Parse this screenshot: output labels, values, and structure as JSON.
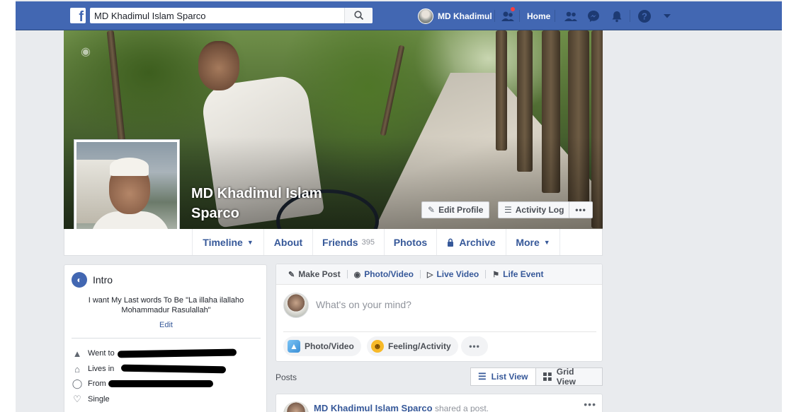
{
  "topbar": {
    "search_value": "MD Khadimul Islam Sparco",
    "user_label": "MD Khadimul",
    "home_label": "Home"
  },
  "profile": {
    "name": "MD Khadimul Islam Sparco",
    "edit_profile_label": "Edit Profile",
    "activity_log_label": "Activity Log"
  },
  "profile_nav": {
    "timeline": "Timeline",
    "about": "About",
    "friends": "Friends",
    "friends_count": "395",
    "photos": "Photos",
    "archive": "Archive",
    "more": "More"
  },
  "intro": {
    "title": "Intro",
    "bio": "I want My Last words To Be \"La illaha ilallaho Mohammadur Rasulallah\"",
    "edit_label": "Edit",
    "went_to_prefix": "Went to",
    "lives_in_prefix": "Lives in",
    "from_prefix": "From",
    "relationship": "Single"
  },
  "composer": {
    "tabs": [
      "Make Post",
      "Photo/Video",
      "Live Video",
      "Life Event"
    ],
    "placeholder": "What's on your mind?",
    "photo_video_pill": "Photo/Video",
    "feeling_pill": "Feeling/Activity"
  },
  "posts": {
    "label": "Posts",
    "list_view": "List View",
    "grid_view": "Grid View",
    "first_post_author": "MD Khadimul Islam Sparco",
    "first_post_action": "shared a post."
  },
  "colors": {
    "brand": "#4267b2",
    "link": "#365899",
    "notification": "#fa3e3e"
  }
}
